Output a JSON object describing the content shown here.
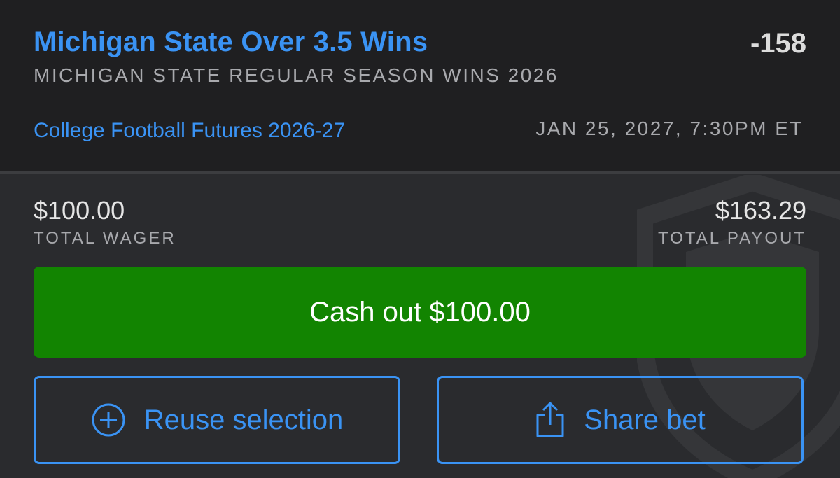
{
  "bet": {
    "title": "Michigan State Over 3.5 Wins",
    "odds": "-158",
    "market": "MICHIGAN STATE REGULAR SEASON WINS 2026",
    "league": "College Football Futures 2026-27",
    "event_date": "JAN 25, 2027, 7:30PM ET"
  },
  "wager": {
    "total_wager_amount": "$100.00",
    "total_wager_label": "TOTAL WAGER",
    "total_payout_amount": "$163.29",
    "total_payout_label": "TOTAL PAYOUT"
  },
  "actions": {
    "cashout_label": "Cash out $100.00",
    "reuse_label": "Reuse selection",
    "reuse_icon": "plus-circle-icon",
    "share_label": "Share bet",
    "share_icon": "share-icon"
  },
  "colors": {
    "accent_blue": "#3a93f4",
    "cashout_green": "#128401",
    "header_bg": "#1f1f21",
    "body_bg": "#2a2b2e"
  }
}
